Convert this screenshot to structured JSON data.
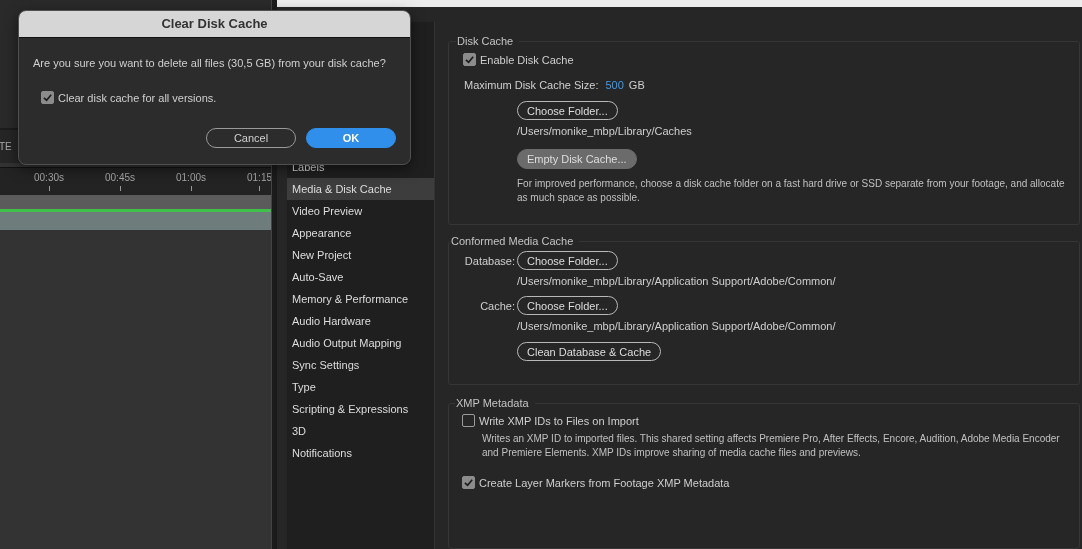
{
  "dialog": {
    "title": "Clear Disk Cache",
    "message": "Are you sure you want to delete all files (30,5 GB) from your disk cache?",
    "checkbox": {
      "label": "Clear disk cache for all versions.",
      "checked": true
    },
    "buttons": [
      {
        "label": "Cancel",
        "kind": "secondary"
      },
      {
        "label": "OK",
        "kind": "primary"
      }
    ]
  },
  "background_panel": {
    "tab_fragment": "TE",
    "timeline_ticks": [
      "00:30s",
      "00:45s",
      "01:00s",
      "01:15"
    ]
  },
  "sidebar": {
    "items": [
      {
        "label": "Labels",
        "selected": false
      },
      {
        "label": "Media & Disk Cache",
        "selected": true
      },
      {
        "label": "Video Preview",
        "selected": false
      },
      {
        "label": "Appearance",
        "selected": false
      },
      {
        "label": "New Project",
        "selected": false
      },
      {
        "label": "Auto-Save",
        "selected": false
      },
      {
        "label": "Memory & Performance",
        "selected": false
      },
      {
        "label": "Audio Hardware",
        "selected": false
      },
      {
        "label": "Audio Output Mapping",
        "selected": false
      },
      {
        "label": "Sync Settings",
        "selected": false
      },
      {
        "label": "Type",
        "selected": false
      },
      {
        "label": "Scripting & Expressions",
        "selected": false
      },
      {
        "label": "3D",
        "selected": false
      },
      {
        "label": "Notifications",
        "selected": false
      }
    ]
  },
  "disk_cache": {
    "title": "Disk Cache",
    "enable": {
      "label": "Enable Disk Cache",
      "checked": true
    },
    "size_label": "Maximum Disk Cache Size:",
    "size_value": "500",
    "size_unit": "GB",
    "choose_button": "Choose Folder...",
    "path": "/Users/monike_mbp/Library/Caches",
    "empty_button": "Empty Disk Cache...",
    "hint": "For improved performance, choose a disk cache folder on a fast hard drive or SSD separate from your footage, and allocate as much space as possible."
  },
  "conformed_media_cache": {
    "title": "Conformed Media Cache",
    "rows": [
      {
        "label": "Database:",
        "button": "Choose Folder...",
        "path": "/Users/monike_mbp/Library/Application Support/Adobe/Common/"
      },
      {
        "label": "Cache:",
        "button": "Choose Folder...",
        "path": "/Users/monike_mbp/Library/Application Support/Adobe/Common/"
      }
    ],
    "clean_button": "Clean Database & Cache"
  },
  "xmp_metadata": {
    "title": "XMP Metadata",
    "options": [
      {
        "label": "Write XMP IDs to Files on Import",
        "checked": false,
        "description": "Writes an XMP ID to imported files. This shared setting affects Premiere Pro, After Effects, Encore, Audition, Adobe Media Encoder and Premiere Elements. XMP IDs improve sharing of media cache files and previews."
      },
      {
        "label": "Create Layer Markers from Footage XMP Metadata",
        "checked": true
      }
    ]
  }
}
